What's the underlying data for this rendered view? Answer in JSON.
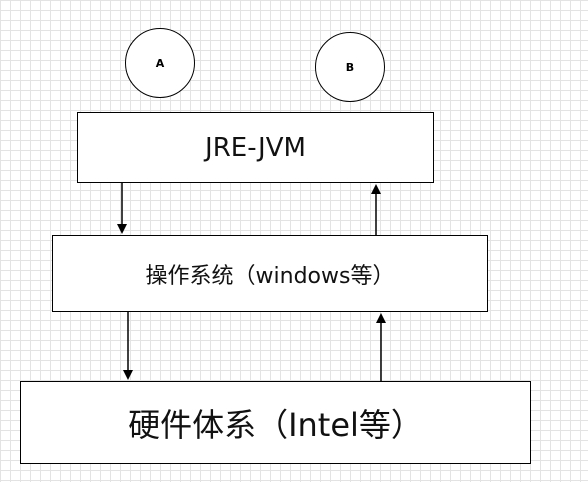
{
  "diagram": {
    "nodes": {
      "circle_a": {
        "label": "A"
      },
      "circle_b": {
        "label": "B"
      },
      "jre_jvm": {
        "label": "JRE-JVM"
      },
      "os": {
        "label": "操作系统（windows等）"
      },
      "hardware": {
        "label": "硬件体系（Intel等）"
      }
    },
    "edges": [
      {
        "from": "jre_jvm",
        "to": "os",
        "direction": "down"
      },
      {
        "from": "os",
        "to": "jre_jvm",
        "direction": "up"
      },
      {
        "from": "os",
        "to": "hardware",
        "direction": "down"
      },
      {
        "from": "hardware",
        "to": "os",
        "direction": "up"
      }
    ],
    "colors": {
      "stroke": "#000000",
      "fill": "#ffffff",
      "grid": "#e3e3e3"
    }
  }
}
